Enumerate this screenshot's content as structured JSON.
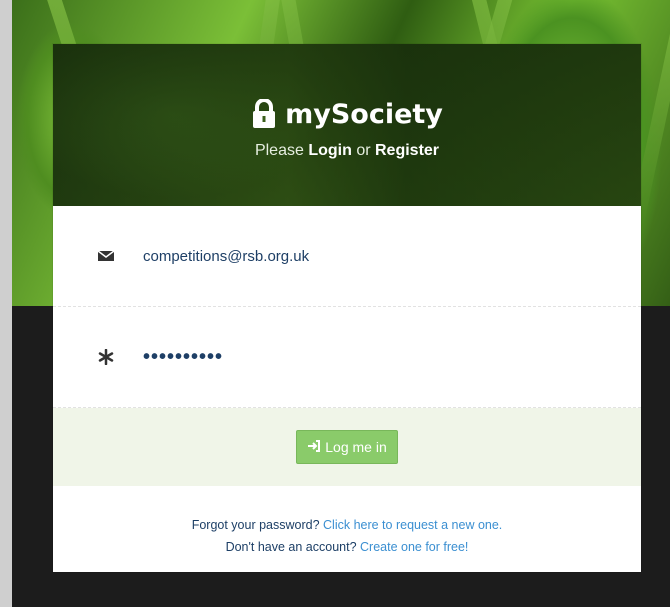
{
  "header": {
    "title": "mySociety",
    "subtitle_parts": [
      "Please ",
      "Login",
      " or ",
      "Register"
    ]
  },
  "form": {
    "email": {
      "value": "competitions@rsb.org.uk",
      "icon": "envelope-icon"
    },
    "password": {
      "value": "••••••••••",
      "icon": "asterisk-icon"
    },
    "submit_label": "Log me in",
    "submit_icon": "sign-in-icon"
  },
  "links": {
    "forgot_text": "Forgot your password?",
    "forgot_link": "Click here to request a new one.",
    "account_text": "Don't have an account?",
    "account_link": "Create one for free!"
  },
  "colors": {
    "button": "#8acb6a",
    "link": "#3b8fd1",
    "text": "#1e3f66",
    "submit_bg": "#f0f5e8"
  }
}
